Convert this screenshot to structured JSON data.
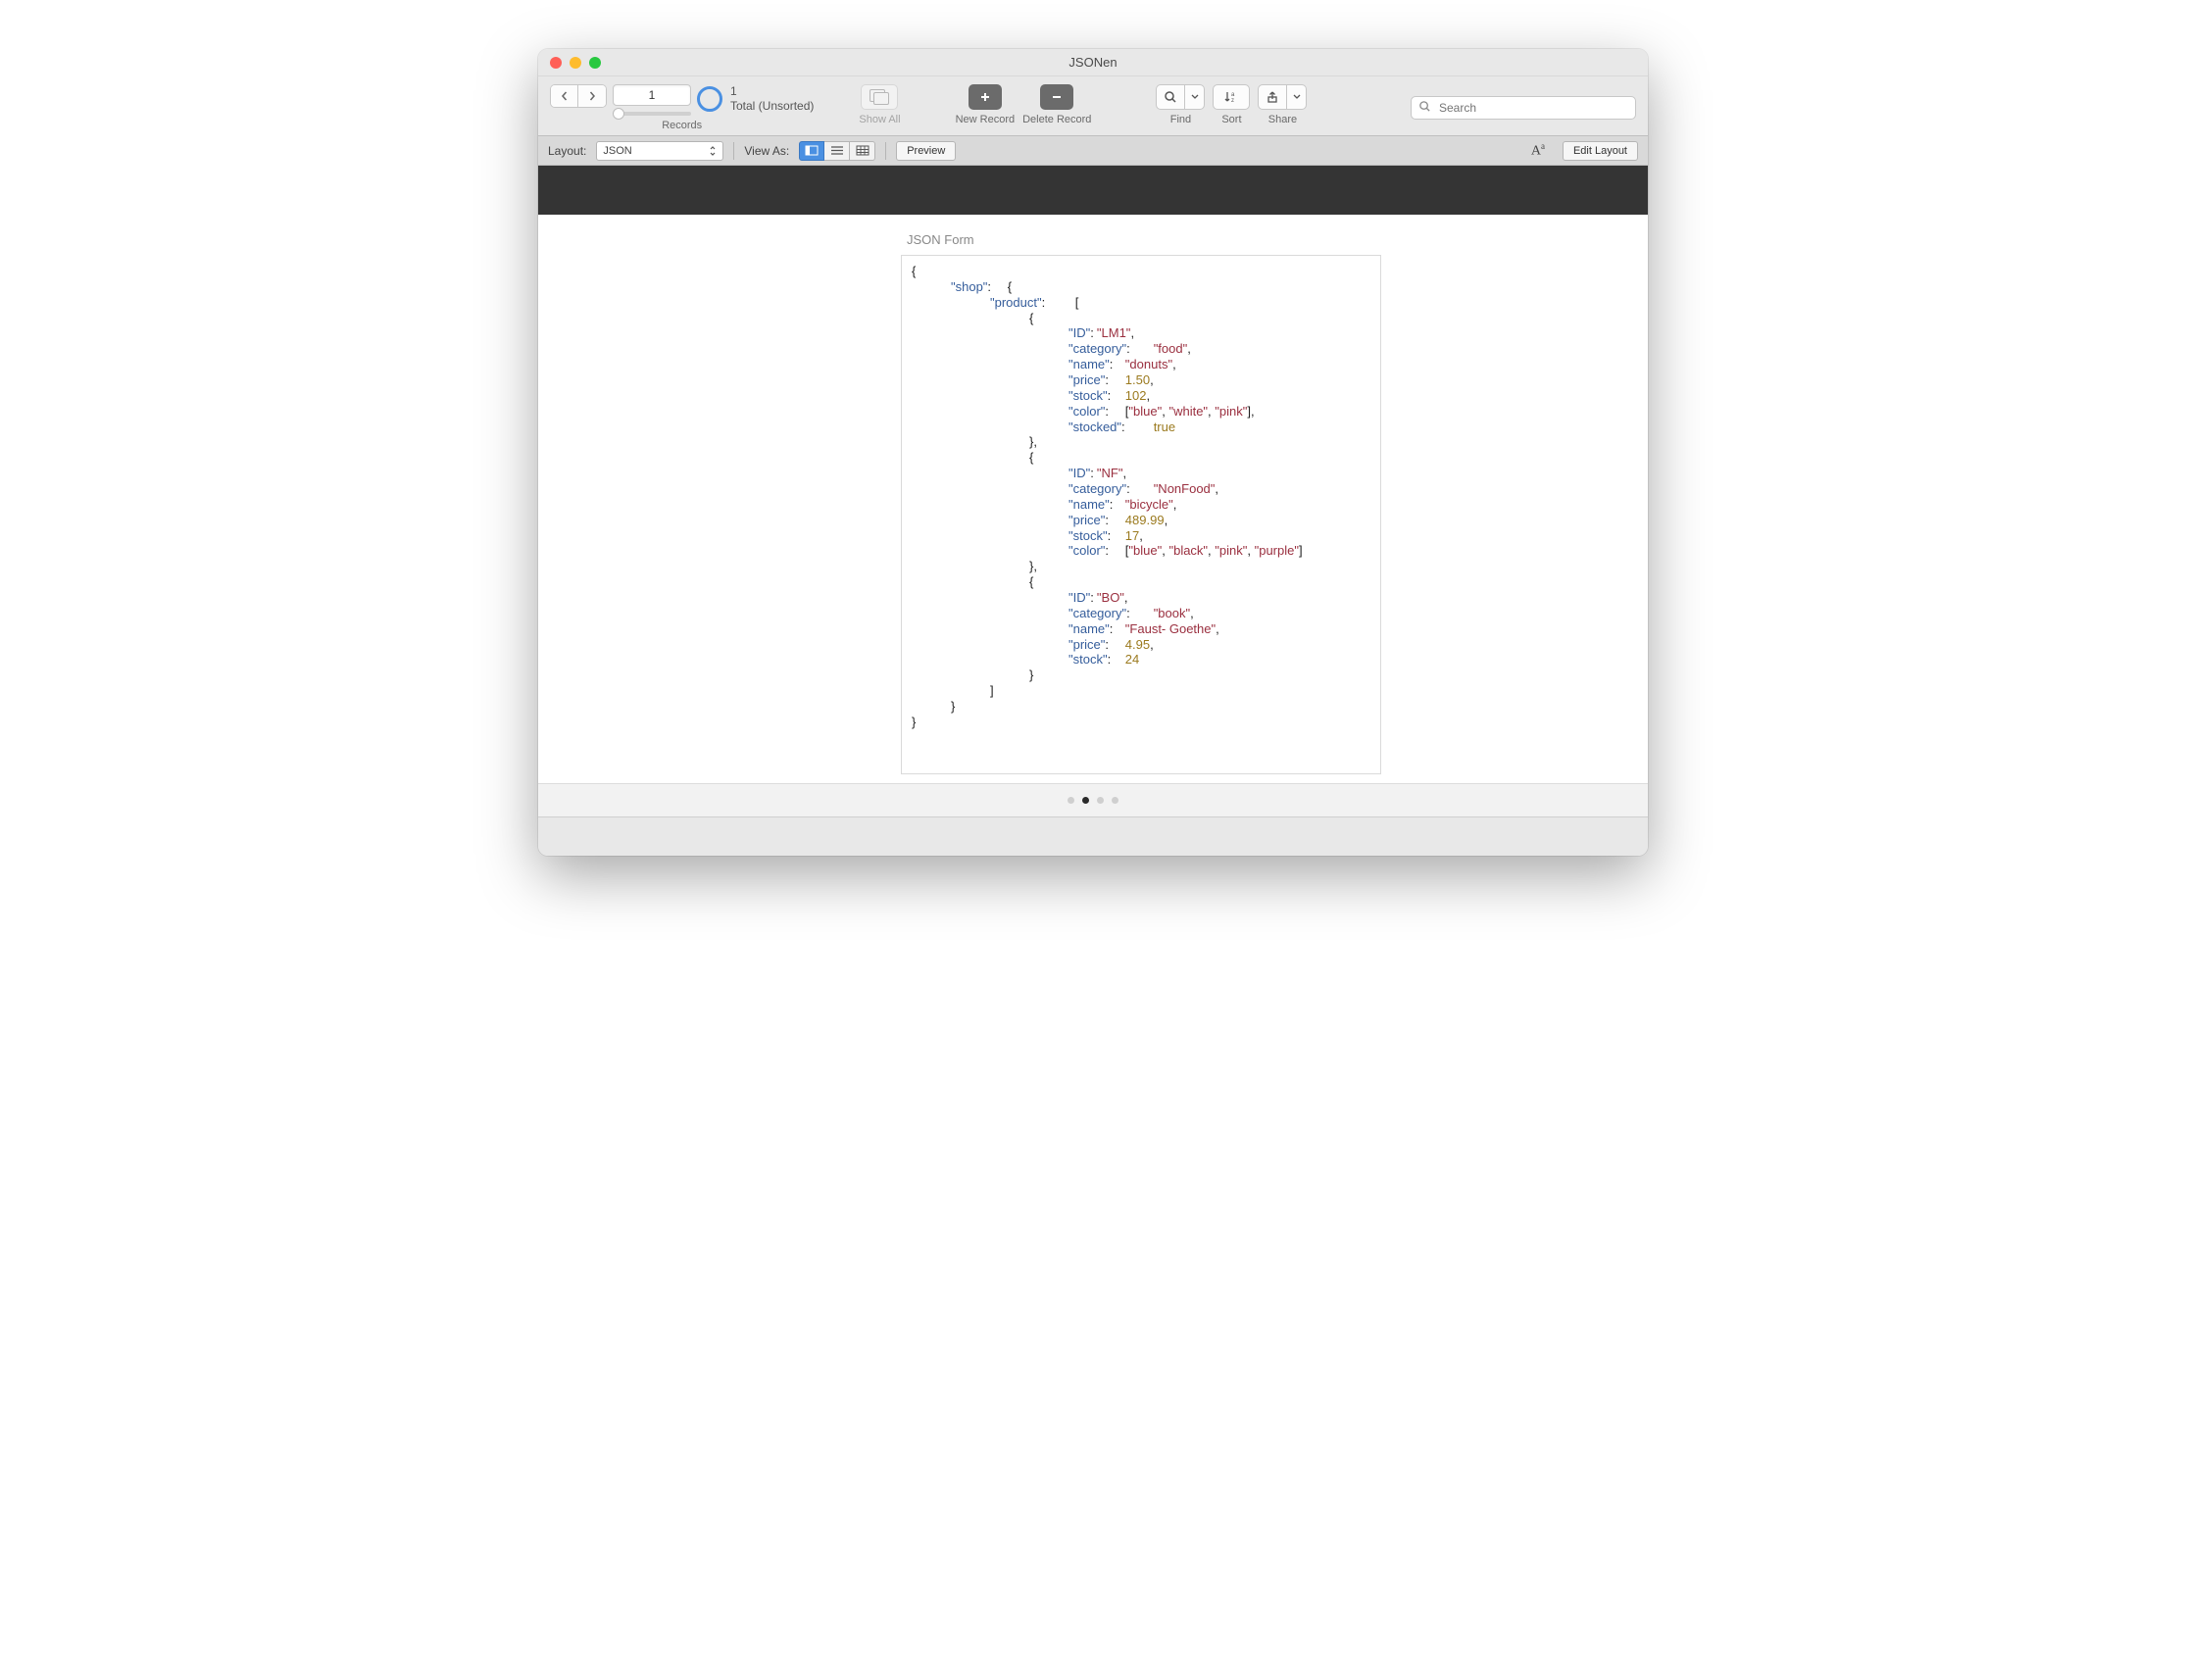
{
  "window": {
    "title": "JSONen"
  },
  "toolbar": {
    "records_label": "Records",
    "record_number": "1",
    "total_count": "1",
    "total_status": "Total (Unsorted)",
    "show_all": "Show All",
    "new_record": "New Record",
    "delete_record": "Delete Record",
    "find": "Find",
    "sort": "Sort",
    "share": "Share",
    "search_placeholder": "Search"
  },
  "formatbar": {
    "layout_label": "Layout:",
    "layout_value": "JSON",
    "view_as_label": "View As:",
    "preview": "Preview",
    "edit_layout": "Edit Layout"
  },
  "content": {
    "form_title": "JSON Form",
    "json": {
      "shop_key": "\"shop\"",
      "product_key": "\"product\"",
      "products": [
        {
          "ID_key": "\"ID\"",
          "ID_val": "\"LM1\"",
          "category_key": "\"category\"",
          "category_val": "\"food\"",
          "name_key": "\"name\"",
          "name_val": "\"donuts\"",
          "price_key": "\"price\"",
          "price_val": "1.50",
          "stock_key": "\"stock\"",
          "stock_val": "102",
          "color_key": "\"color\"",
          "color_vals": [
            "\"blue\"",
            "\"white\"",
            "\"pink\""
          ],
          "stocked_key": "\"stocked\"",
          "stocked_val": "true"
        },
        {
          "ID_key": "\"ID\"",
          "ID_val": "\"NF\"",
          "category_key": "\"category\"",
          "category_val": "\"NonFood\"",
          "name_key": "\"name\"",
          "name_val": "\"bicycle\"",
          "price_key": "\"price\"",
          "price_val": "489.99",
          "stock_key": "\"stock\"",
          "stock_val": "17",
          "color_key": "\"color\"",
          "color_vals": [
            "\"blue\"",
            "\"black\"",
            "\"pink\"",
            "\"purple\""
          ]
        },
        {
          "ID_key": "\"ID\"",
          "ID_val": "\"BO\"",
          "category_key": "\"category\"",
          "category_val": "\"book\"",
          "name_key": "\"name\"",
          "name_val": "\"Faust- Goethe\"",
          "price_key": "\"price\"",
          "price_val": "4.95",
          "stock_key": "\"stock\"",
          "stock_val": "24"
        }
      ]
    }
  },
  "pager": {
    "active_index": 1,
    "count": 4
  }
}
